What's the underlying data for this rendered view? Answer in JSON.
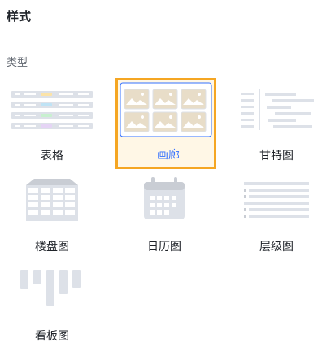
{
  "panel": {
    "title": "样式",
    "section_label": "类型",
    "selected": "gallery"
  },
  "view_types": [
    {
      "id": "table",
      "label": "表格",
      "icon": "table-view-icon"
    },
    {
      "id": "gallery",
      "label": "画廊",
      "icon": "gallery-view-icon"
    },
    {
      "id": "gantt",
      "label": "甘特图",
      "icon": "gantt-view-icon"
    },
    {
      "id": "floorplan",
      "label": "楼盘图",
      "icon": "floorplan-view-icon"
    },
    {
      "id": "calendar",
      "label": "日历图",
      "icon": "calendar-view-icon"
    },
    {
      "id": "hierarchy",
      "label": "层级图",
      "icon": "hierarchy-view-icon"
    },
    {
      "id": "kanban",
      "label": "看板图",
      "icon": "kanban-view-icon"
    }
  ],
  "colors": {
    "icon_fill": "#dde1e8",
    "icon_dark": "#c9cdd4",
    "selected_border": "#f5a623",
    "selected_bg": "#fff7e6",
    "selected_text": "#3370ff"
  }
}
